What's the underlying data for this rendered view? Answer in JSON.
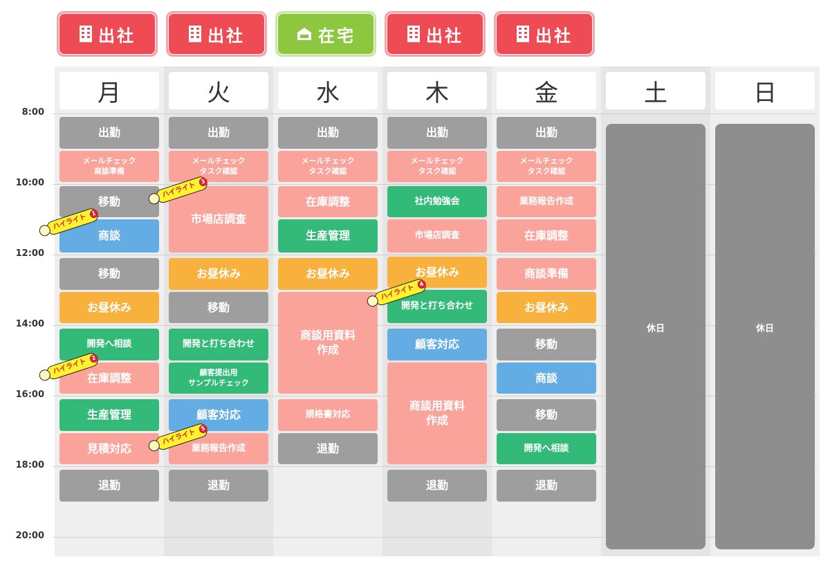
{
  "status_tags": [
    {
      "icon": "building-icon",
      "label": "出社",
      "color": "#ee4b55"
    },
    {
      "icon": "building-icon",
      "label": "出社",
      "color": "#ee4b55"
    },
    {
      "icon": "house-icon",
      "label": "在宅",
      "color": "#8dc63f"
    },
    {
      "icon": "building-icon",
      "label": "出社",
      "color": "#ee4b55"
    },
    {
      "icon": "building-icon",
      "label": "出社",
      "color": "#ee4b55"
    }
  ],
  "days": [
    "月",
    "火",
    "水",
    "木",
    "金",
    "土",
    "日"
  ],
  "times": [
    "8:00",
    "10:00",
    "12:00",
    "14:00",
    "16:00",
    "18:00",
    "20:00"
  ],
  "events": [
    [
      {
        "label": "出勤",
        "color": "gray",
        "start": 8.1,
        "end": 9.0
      },
      {
        "label": "メールチェック\n商談準備",
        "color": "pink",
        "start": 9.05,
        "end": 9.95,
        "size": "tiny"
      },
      {
        "label": "移動",
        "color": "gray",
        "start": 10.05,
        "end": 10.95
      },
      {
        "label": "商談",
        "color": "blue",
        "start": 11.0,
        "end": 11.95
      },
      {
        "label": "移動",
        "color": "gray",
        "start": 12.1,
        "end": 13.0
      },
      {
        "label": "お昼休み",
        "color": "orange",
        "start": 13.05,
        "end": 13.95
      },
      {
        "label": "開発へ相談",
        "color": "green",
        "start": 14.1,
        "end": 15.0,
        "size": "small"
      },
      {
        "label": "在庫調整",
        "color": "pink",
        "start": 15.05,
        "end": 15.95
      },
      {
        "label": "生産管理",
        "color": "green",
        "start": 16.1,
        "end": 17.0
      },
      {
        "label": "見積対応",
        "color": "pink",
        "start": 17.05,
        "end": 17.95
      },
      {
        "label": "退勤",
        "color": "gray",
        "start": 18.1,
        "end": 19.0
      }
    ],
    [
      {
        "label": "出勤",
        "color": "gray",
        "start": 8.1,
        "end": 9.0
      },
      {
        "label": "メールチェック\nタスク確認",
        "color": "pink",
        "start": 9.05,
        "end": 9.95,
        "size": "tiny"
      },
      {
        "label": "市場店調査",
        "color": "pink",
        "start": 10.05,
        "end": 11.95
      },
      {
        "label": "お昼休み",
        "color": "orange",
        "start": 12.1,
        "end": 13.0
      },
      {
        "label": "移動",
        "color": "gray",
        "start": 13.05,
        "end": 13.95
      },
      {
        "label": "開発と打ち合わせ",
        "color": "green",
        "start": 14.1,
        "end": 15.0,
        "size": "small"
      },
      {
        "label": "顧客提出用\nサンプルチェック",
        "color": "green",
        "start": 15.05,
        "end": 15.95,
        "size": "tiny"
      },
      {
        "label": "顧客対応",
        "color": "blue",
        "start": 16.1,
        "end": 17.0
      },
      {
        "label": "業務報告作成",
        "color": "pink",
        "start": 17.05,
        "end": 17.95,
        "size": "small"
      },
      {
        "label": "退勤",
        "color": "gray",
        "start": 18.1,
        "end": 19.0
      }
    ],
    [
      {
        "label": "出勤",
        "color": "gray",
        "start": 8.1,
        "end": 9.0
      },
      {
        "label": "メールチェック\nタスク確認",
        "color": "pink",
        "start": 9.05,
        "end": 9.95,
        "size": "tiny"
      },
      {
        "label": "在庫調整",
        "color": "pink",
        "start": 10.05,
        "end": 10.95
      },
      {
        "label": "生産管理",
        "color": "green",
        "start": 11.0,
        "end": 11.95
      },
      {
        "label": "お昼休み",
        "color": "orange",
        "start": 12.1,
        "end": 13.0
      },
      {
        "label": "商談用資料\n作成",
        "color": "pink",
        "start": 13.05,
        "end": 15.95
      },
      {
        "label": "規格書対応",
        "color": "pink",
        "start": 16.1,
        "end": 17.0,
        "size": "small"
      },
      {
        "label": "退勤",
        "color": "gray",
        "start": 17.05,
        "end": 17.95
      }
    ],
    [
      {
        "label": "出勤",
        "color": "gray",
        "start": 8.1,
        "end": 9.0
      },
      {
        "label": "メールチェック\nタスク確認",
        "color": "pink",
        "start": 9.05,
        "end": 9.95,
        "size": "tiny"
      },
      {
        "label": "社内勉強会",
        "color": "green",
        "start": 10.05,
        "end": 10.95,
        "size": "small"
      },
      {
        "label": "市場店調査",
        "color": "pink",
        "start": 11.0,
        "end": 11.95,
        "size": "small"
      },
      {
        "label": "お昼休み",
        "color": "orange",
        "start": 12.05,
        "end": 12.95
      },
      {
        "label": "開発と打ち合わせ",
        "color": "green",
        "start": 13.0,
        "end": 13.95,
        "size": "small"
      },
      {
        "label": "顧客対応",
        "color": "blue",
        "start": 14.1,
        "end": 15.0
      },
      {
        "label": "商談用資料\n作成",
        "color": "pink",
        "start": 15.05,
        "end": 17.95
      },
      {
        "label": "退勤",
        "color": "gray",
        "start": 18.1,
        "end": 19.0
      }
    ],
    [
      {
        "label": "出勤",
        "color": "gray",
        "start": 8.1,
        "end": 9.0
      },
      {
        "label": "メールチェック\nタスク確認",
        "color": "pink",
        "start": 9.05,
        "end": 9.95,
        "size": "tiny"
      },
      {
        "label": "業務報告作成",
        "color": "pink",
        "start": 10.05,
        "end": 10.95,
        "size": "small"
      },
      {
        "label": "在庫調整",
        "color": "pink",
        "start": 11.0,
        "end": 11.95
      },
      {
        "label": "商談準備",
        "color": "pink",
        "start": 12.1,
        "end": 13.0
      },
      {
        "label": "お昼休み",
        "color": "orange",
        "start": 13.05,
        "end": 13.95
      },
      {
        "label": "移動",
        "color": "gray",
        "start": 14.1,
        "end": 15.0
      },
      {
        "label": "商談",
        "color": "blue",
        "start": 15.05,
        "end": 15.95
      },
      {
        "label": "移動",
        "color": "gray",
        "start": 16.1,
        "end": 17.0
      },
      {
        "label": "開発へ相談",
        "color": "green",
        "start": 17.05,
        "end": 17.95,
        "size": "small"
      },
      {
        "label": "退勤",
        "color": "gray",
        "start": 18.1,
        "end": 19.0
      }
    ],
    [
      {
        "label": "休日",
        "color": "dark",
        "start": 8.3,
        "end": 20.35,
        "size": "small"
      }
    ],
    [
      {
        "label": "休日",
        "color": "dark",
        "start": 8.3,
        "end": 20.35,
        "size": "small"
      }
    ]
  ],
  "highlights": [
    {
      "label": "ハイライト",
      "num": "1",
      "day": 0,
      "time": 11.1
    },
    {
      "label": "ハイライト",
      "num": "2",
      "day": 0,
      "time": 15.2
    },
    {
      "label": "ハイライト",
      "num": "3",
      "day": 1,
      "time": 10.2
    },
    {
      "label": "ハイライト",
      "num": "4",
      "day": 3,
      "time": 13.1
    },
    {
      "label": "ハイライト",
      "num": "5",
      "day": 1,
      "time": 17.2
    }
  ]
}
